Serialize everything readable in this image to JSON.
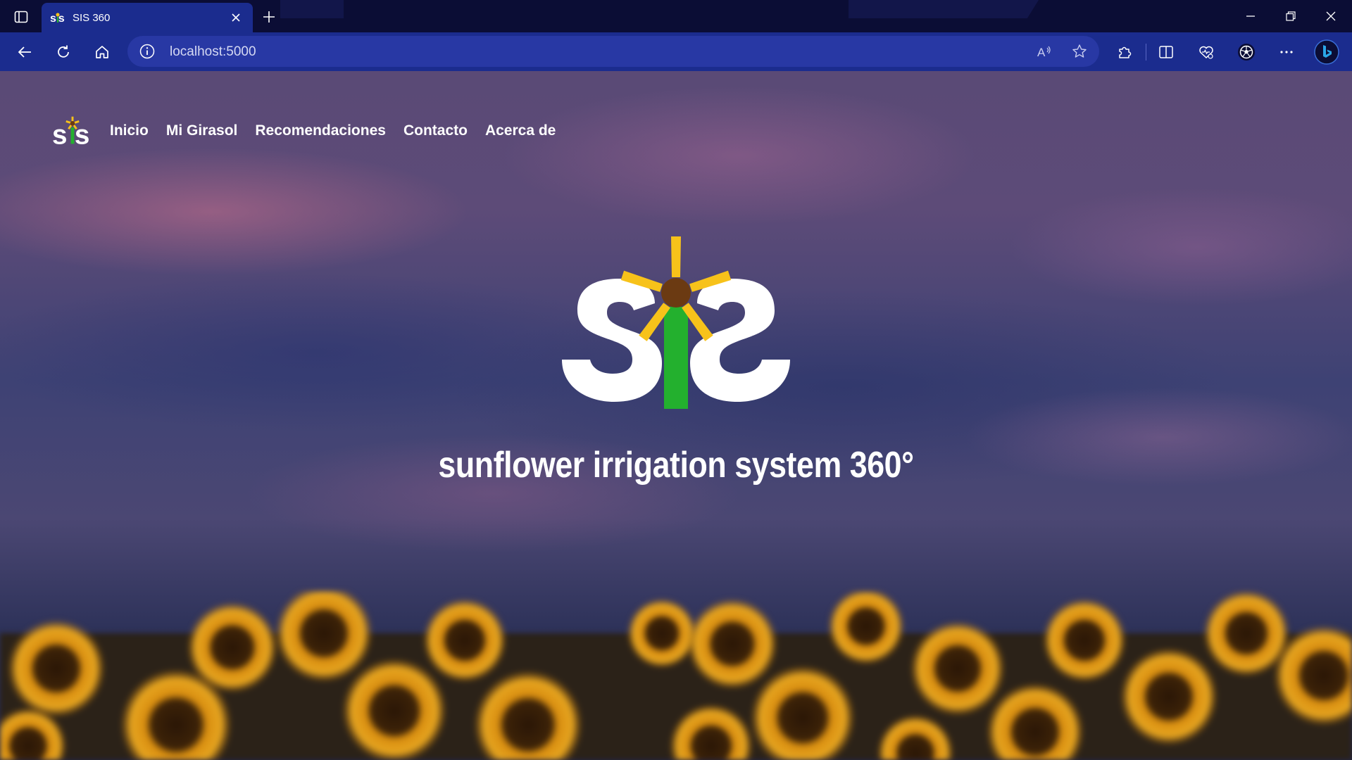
{
  "browser": {
    "tab": {
      "title": "SIS 360"
    },
    "address": {
      "url": "localhost:5000"
    },
    "icons": {
      "sidebar": "sidebar-icon",
      "close_tab": "close-icon",
      "new_tab": "plus-icon",
      "back": "back-arrow-icon",
      "refresh": "refresh-icon",
      "home": "home-icon",
      "info": "info-icon",
      "read_aloud": "read-aloud-icon",
      "favorite": "star-icon",
      "extensions": "puzzle-icon",
      "split_screen": "split-screen-icon",
      "health": "browser-essentials-icon",
      "workspace": "soccer-ball-icon",
      "more": "more-icon",
      "copilot": "bing-copilot-icon"
    }
  },
  "site": {
    "nav": {
      "links": [
        "Inicio",
        "Mi Girasol",
        "Recomendaciones",
        "Contacto",
        "Acerca de"
      ]
    },
    "hero": {
      "tagline": "sunflower irrigation system 360°"
    },
    "colors": {
      "petal": "#f7c21a",
      "flower_center": "#6b3a12",
      "stem": "#23b02e",
      "chrome": "#1b2c8e",
      "titlebar": "#0b0d35"
    }
  }
}
